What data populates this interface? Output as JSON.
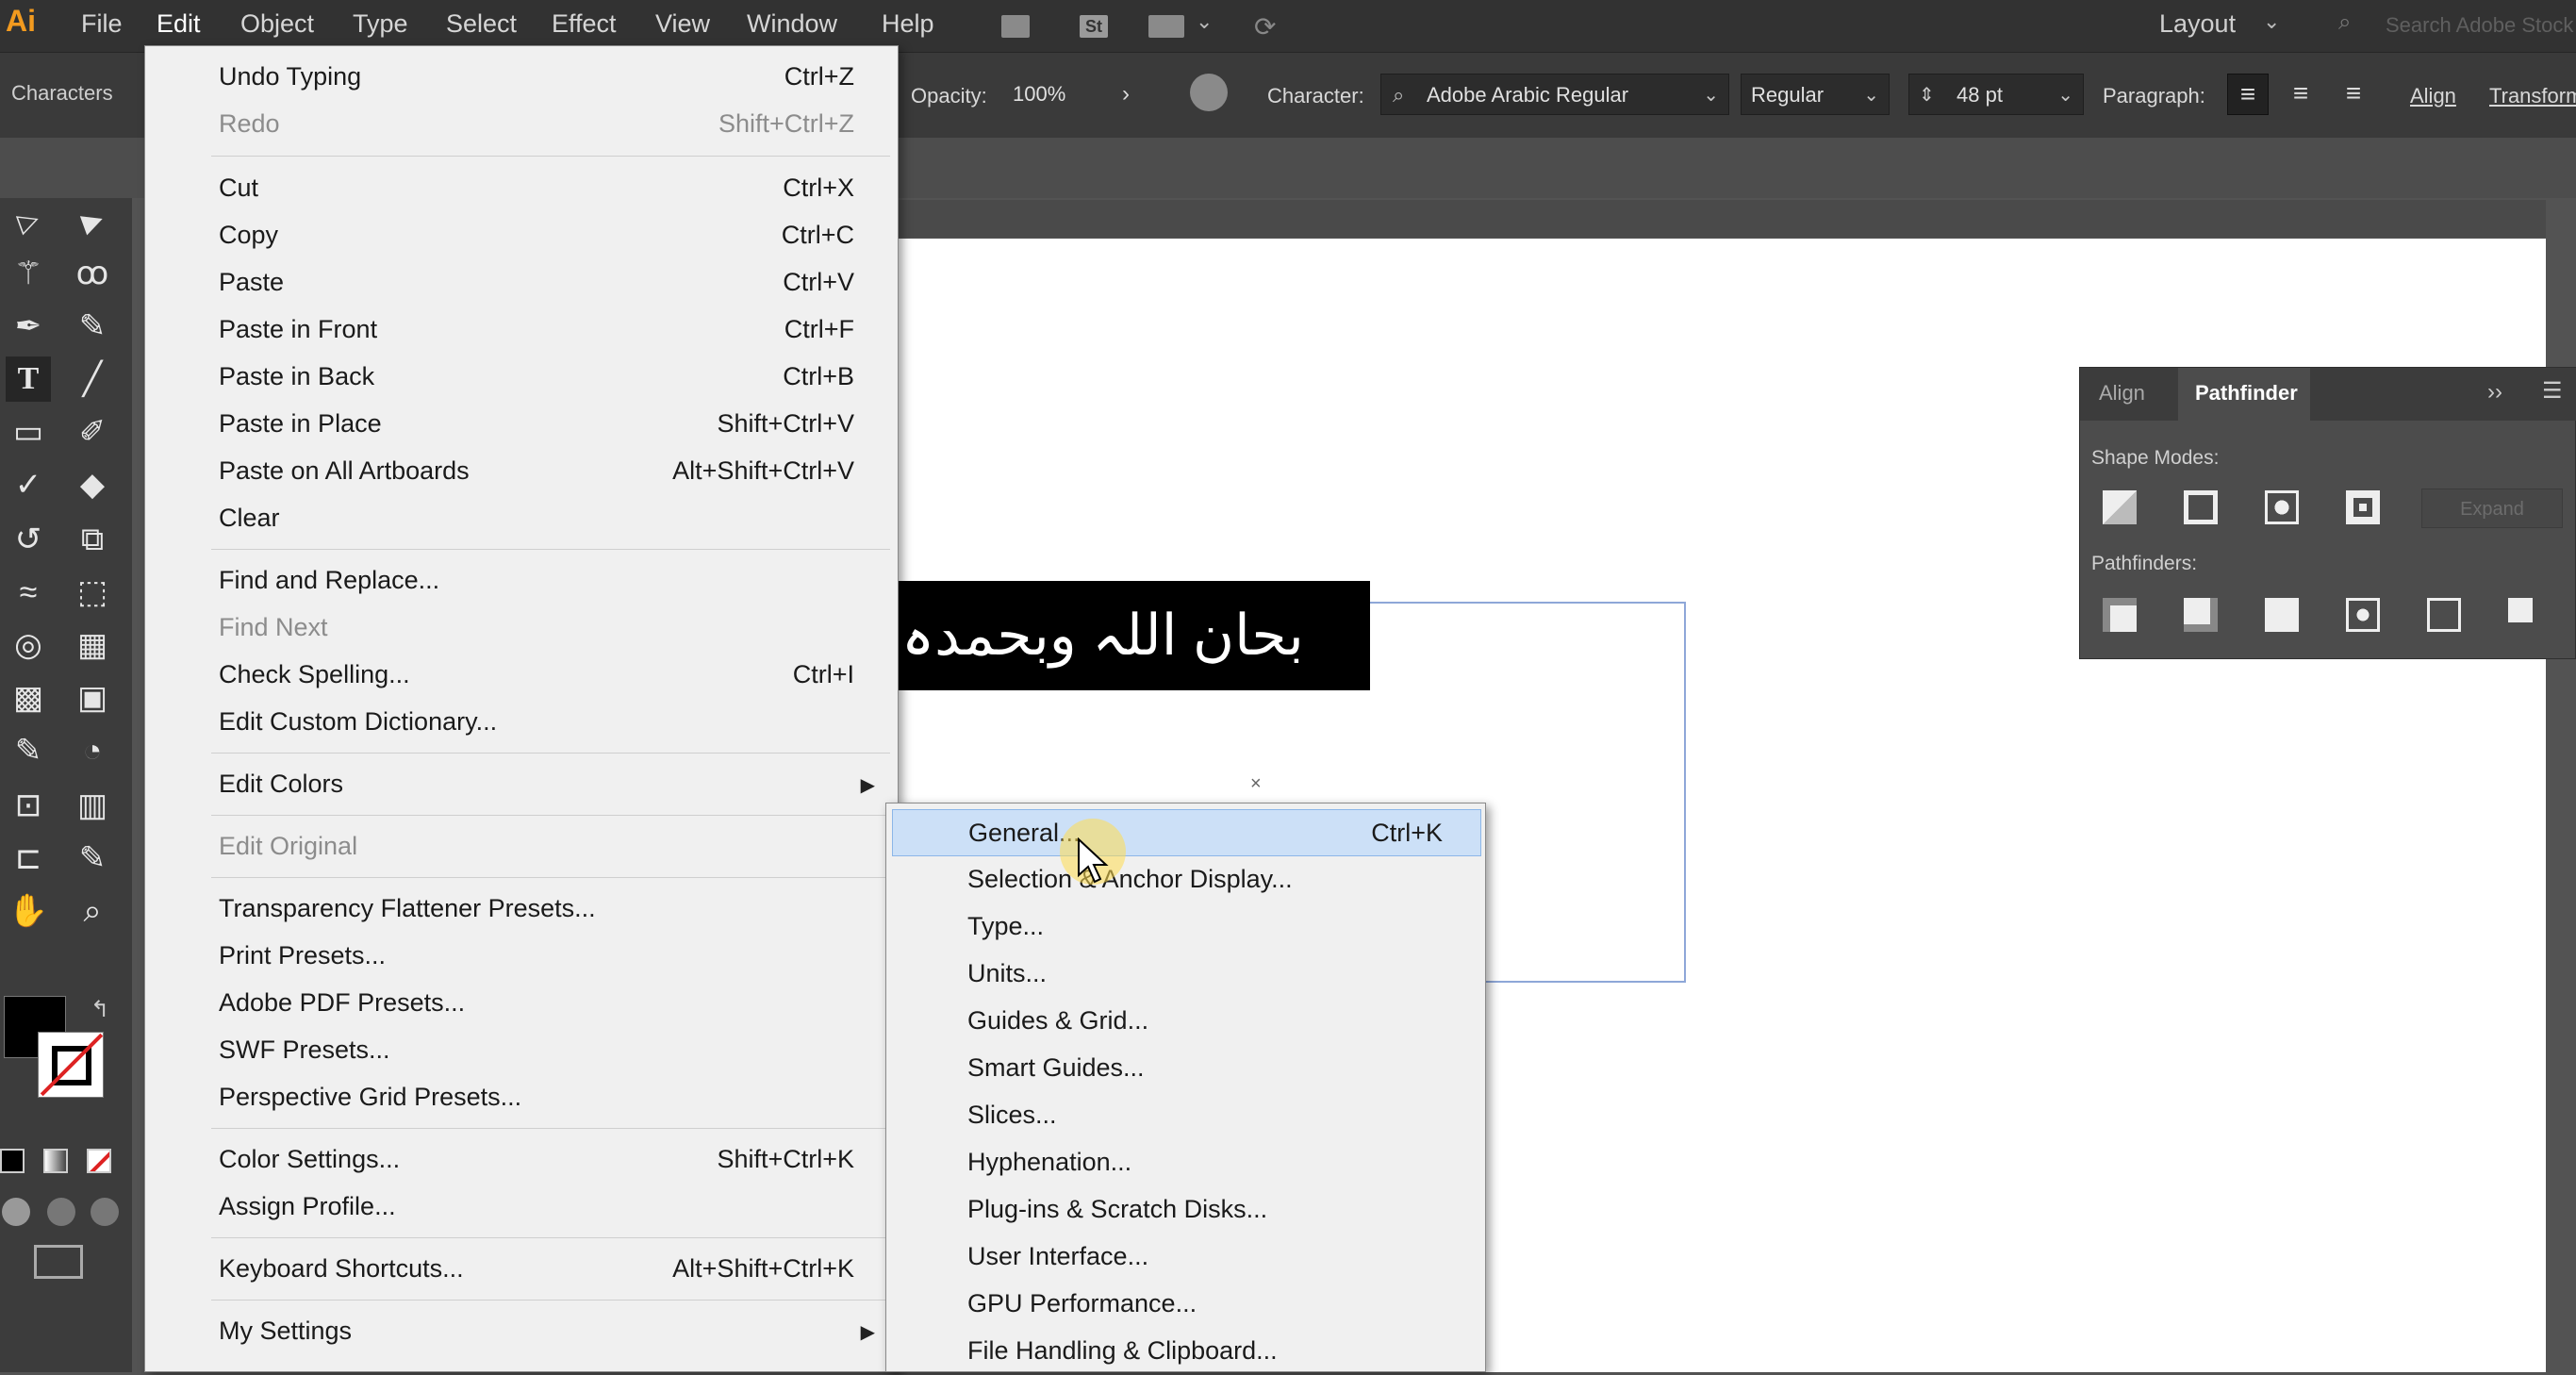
{
  "menubar": {
    "logo": "Ai",
    "items": [
      "File",
      "Edit",
      "Object",
      "Type",
      "Select",
      "Effect",
      "View",
      "Window",
      "Help"
    ],
    "workspace": "Layout",
    "search_placeholder": "Search Adobe Stock"
  },
  "control_bar": {
    "panel_label": "Characters",
    "opacity_label": "Opacity:",
    "opacity_value": "100%",
    "character_label": "Character:",
    "font_family": "Adobe Arabic Regular",
    "font_style": "Regular",
    "font_size": "48 pt",
    "paragraph_label": "Paragraph:",
    "align_label": "Align",
    "transform_label": "Transform"
  },
  "artboard": {
    "text": "بحان اللہ وبحمدہ"
  },
  "pathfinder_panel": {
    "tabs": [
      "Align",
      "Pathfinder"
    ],
    "active_tab": "Pathfinder",
    "shape_modes_label": "Shape Modes:",
    "pathfinders_label": "Pathfinders:",
    "expand_label": "Expand",
    "more": "››"
  },
  "edit_menu": {
    "items": [
      {
        "label": "Undo Typing",
        "shortcut": "Ctrl+Z",
        "disabled": false
      },
      {
        "label": "Redo",
        "shortcut": "Shift+Ctrl+Z",
        "disabled": true
      },
      {
        "label": "Cut",
        "shortcut": "Ctrl+X",
        "disabled": false
      },
      {
        "label": "Copy",
        "shortcut": "Ctrl+C",
        "disabled": false
      },
      {
        "label": "Paste",
        "shortcut": "Ctrl+V",
        "disabled": false
      },
      {
        "label": "Paste in Front",
        "shortcut": "Ctrl+F",
        "disabled": false
      },
      {
        "label": "Paste in Back",
        "shortcut": "Ctrl+B",
        "disabled": false
      },
      {
        "label": "Paste in Place",
        "shortcut": "Shift+Ctrl+V",
        "disabled": false
      },
      {
        "label": "Paste on All Artboards",
        "shortcut": "Alt+Shift+Ctrl+V",
        "disabled": false
      },
      {
        "label": "Clear",
        "shortcut": "",
        "disabled": false
      },
      {
        "label": "Find and Replace...",
        "shortcut": "",
        "disabled": false
      },
      {
        "label": "Find Next",
        "shortcut": "",
        "disabled": true
      },
      {
        "label": "Check Spelling...",
        "shortcut": "Ctrl+I",
        "disabled": false
      },
      {
        "label": "Edit Custom Dictionary...",
        "shortcut": "",
        "disabled": false
      },
      {
        "label": "Edit Colors",
        "shortcut": "",
        "disabled": false,
        "submenu": true
      },
      {
        "label": "Edit Original",
        "shortcut": "",
        "disabled": true
      },
      {
        "label": "Transparency Flattener Presets...",
        "shortcut": "",
        "disabled": false
      },
      {
        "label": "Print Presets...",
        "shortcut": "",
        "disabled": false
      },
      {
        "label": "Adobe PDF Presets...",
        "shortcut": "",
        "disabled": false
      },
      {
        "label": "SWF Presets...",
        "shortcut": "",
        "disabled": false
      },
      {
        "label": "Perspective Grid Presets...",
        "shortcut": "",
        "disabled": false
      },
      {
        "label": "Color Settings...",
        "shortcut": "Shift+Ctrl+K",
        "disabled": false
      },
      {
        "label": "Assign Profile...",
        "shortcut": "",
        "disabled": false
      },
      {
        "label": "Keyboard Shortcuts...",
        "shortcut": "Alt+Shift+Ctrl+K",
        "disabled": false
      },
      {
        "label": "My Settings",
        "shortcut": "",
        "disabled": false,
        "submenu": true
      }
    ]
  },
  "preferences_submenu": {
    "items": [
      {
        "label": "General...",
        "shortcut": "Ctrl+K",
        "highlighted": true
      },
      {
        "label": "Selection & Anchor Display...",
        "shortcut": ""
      },
      {
        "label": "Type...",
        "shortcut": ""
      },
      {
        "label": "Units...",
        "shortcut": ""
      },
      {
        "label": "Guides & Grid...",
        "shortcut": ""
      },
      {
        "label": "Smart Guides...",
        "shortcut": ""
      },
      {
        "label": "Slices...",
        "shortcut": ""
      },
      {
        "label": "Hyphenation...",
        "shortcut": ""
      },
      {
        "label": "Plug-ins & Scratch Disks...",
        "shortcut": ""
      },
      {
        "label": "User Interface...",
        "shortcut": ""
      },
      {
        "label": "GPU Performance...",
        "shortcut": ""
      },
      {
        "label": "File Handling & Clipboard...",
        "shortcut": ""
      }
    ]
  },
  "colors": {
    "menu_bg": "#f0f0f0",
    "highlight": "#cce0f7",
    "app_dark": "#323232",
    "logo": "#f29a1f"
  }
}
